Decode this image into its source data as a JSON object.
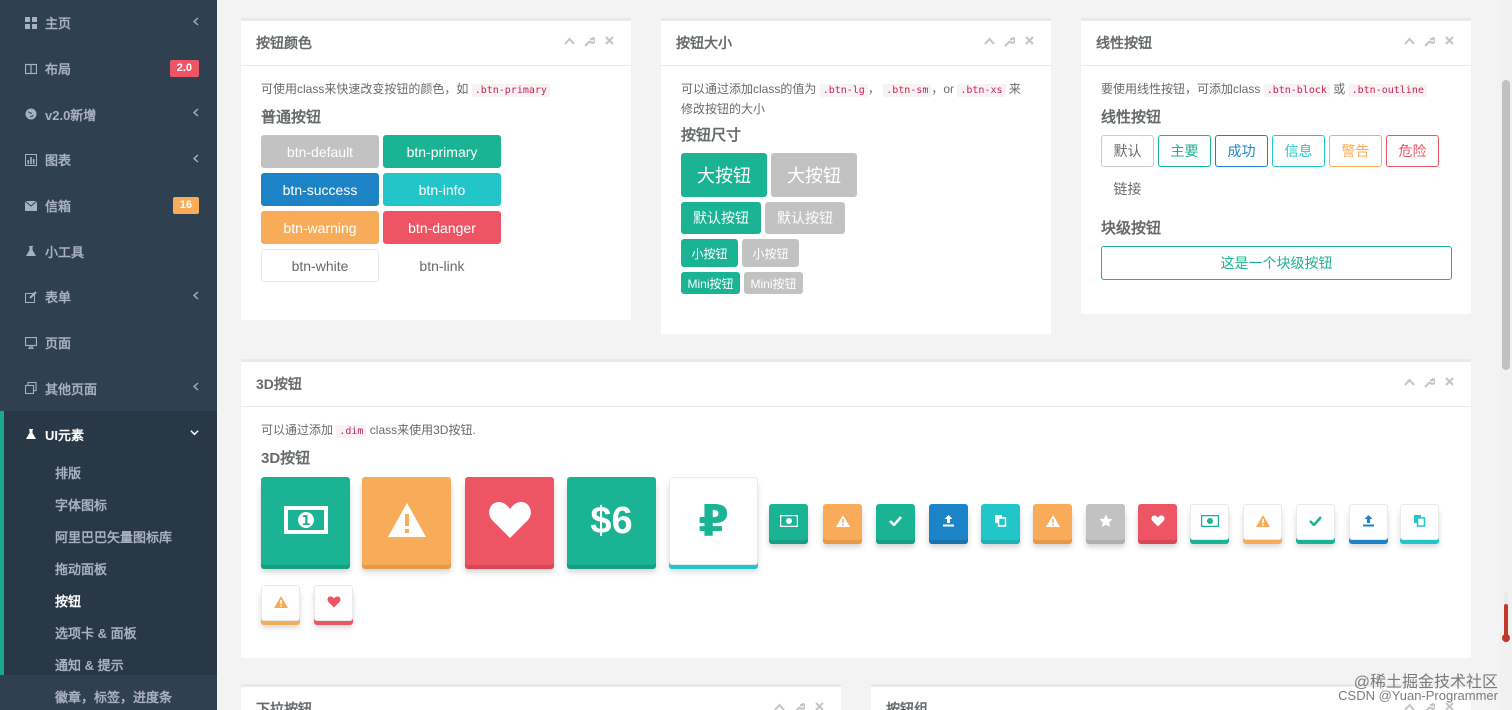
{
  "sidebar": {
    "items": [
      {
        "label": "主页",
        "icon": "grid-icon",
        "arrow": "‹"
      },
      {
        "label": "布局",
        "icon": "columns-icon",
        "badge": "2.0"
      },
      {
        "label": "v2.0新增",
        "icon": "globe-icon",
        "arrow": "‹"
      },
      {
        "label": "图表",
        "icon": "chart-icon",
        "arrow": "‹"
      },
      {
        "label": "信箱",
        "icon": "envelope-icon",
        "badge": "16"
      },
      {
        "label": "小工具",
        "icon": "flask-icon"
      },
      {
        "label": "表单",
        "icon": "edit-icon",
        "arrow": "‹"
      },
      {
        "label": "页面",
        "icon": "desktop-icon"
      },
      {
        "label": "其他页面",
        "icon": "files-icon",
        "arrow": "‹"
      }
    ],
    "active": {
      "label": "UI元素",
      "icon": "flask-icon",
      "arrow": "⌄",
      "sub": [
        "排版",
        "字体图标",
        "阿里巴巴矢量图标库",
        "拖动面板",
        "按钮",
        "选项卡 & 面板",
        "通知 & 提示",
        "徽章，标签，进度条"
      ]
    }
  },
  "colors": {
    "primary": "#1ab394",
    "success": "#1c84c6",
    "info": "#23c6c8",
    "warning": "#f8ac59",
    "danger": "#ed5565",
    "default": "#c2c2c2",
    "sidebar": "#2f4050"
  },
  "panel_colors": {
    "title": "按钮颜色",
    "desc": "可使用class来快速改变按钮的颜色，如",
    "code": ".btn-primary",
    "heading": "普通按钮",
    "buttons": [
      "btn-default",
      "btn-primary",
      "btn-success",
      "btn-info",
      "btn-warning",
      "btn-danger",
      "btn-white",
      "btn-link"
    ]
  },
  "panel_sizes": {
    "title": "按钮大小",
    "desc_a": "可以通过添加class的值为",
    "code_lg": ".btn-lg",
    "sep1": "，",
    "code_sm": ".btn-sm",
    "sep2": "，or",
    "code_xs": ".btn-xs",
    "desc_b": "来",
    "desc_c": "修改按钮的大小",
    "heading": "按钮尺寸",
    "lg": "大按钮",
    "md": "默认按钮",
    "sm": "小按钮",
    "xs": "Mini按钮"
  },
  "panel_outline": {
    "title": "线性按钮",
    "desc": "要使用线性按钮，可添加class",
    "code_block": ".btn-block",
    "or": "或",
    "code_outline": ".btn-outline",
    "heading": "线性按钮",
    "buttons": [
      "默认",
      "主要",
      "成功",
      "信息",
      "警告",
      "危险"
    ],
    "link": "链接",
    "block_heading": "块级按钮",
    "block_button": "这是一个块级按钮"
  },
  "panel_3d": {
    "title": "3D按钮",
    "desc_a": "可以通过添加",
    "code": ".dim",
    "desc_b": "class来使用3D按钮.",
    "heading": "3D按钮",
    "dollar_label": "$6",
    "ruble_label": "₽",
    "large": [
      {
        "icon": "money-icon"
      },
      {
        "icon": "warning-icon"
      },
      {
        "icon": "heart-icon"
      },
      {
        "icon": "dollar-icon"
      },
      {
        "icon": "ruble-icon"
      }
    ],
    "small": [
      {
        "icon": "money-icon"
      },
      {
        "icon": "warning-icon"
      },
      {
        "icon": "check-icon"
      },
      {
        "icon": "upload-icon"
      },
      {
        "icon": "copy-icon"
      },
      {
        "icon": "warning-icon"
      },
      {
        "icon": "star-icon"
      },
      {
        "icon": "heart-icon"
      },
      {
        "icon": "money-icon"
      },
      {
        "icon": "warning-icon"
      },
      {
        "icon": "check-icon"
      },
      {
        "icon": "upload-icon"
      },
      {
        "icon": "copy-icon"
      },
      {
        "icon": "warning-icon"
      },
      {
        "icon": "heart-icon"
      }
    ]
  },
  "panel_dropdown": {
    "title": "下拉按钮"
  },
  "panel_group": {
    "title": "按钮组"
  },
  "tools": {
    "collapse": "⌃",
    "config": "🔧",
    "close": "✕"
  },
  "watermark": {
    "line1": "@稀土掘金技术社区",
    "line2": "CSDN @Yuan-Programmer"
  }
}
